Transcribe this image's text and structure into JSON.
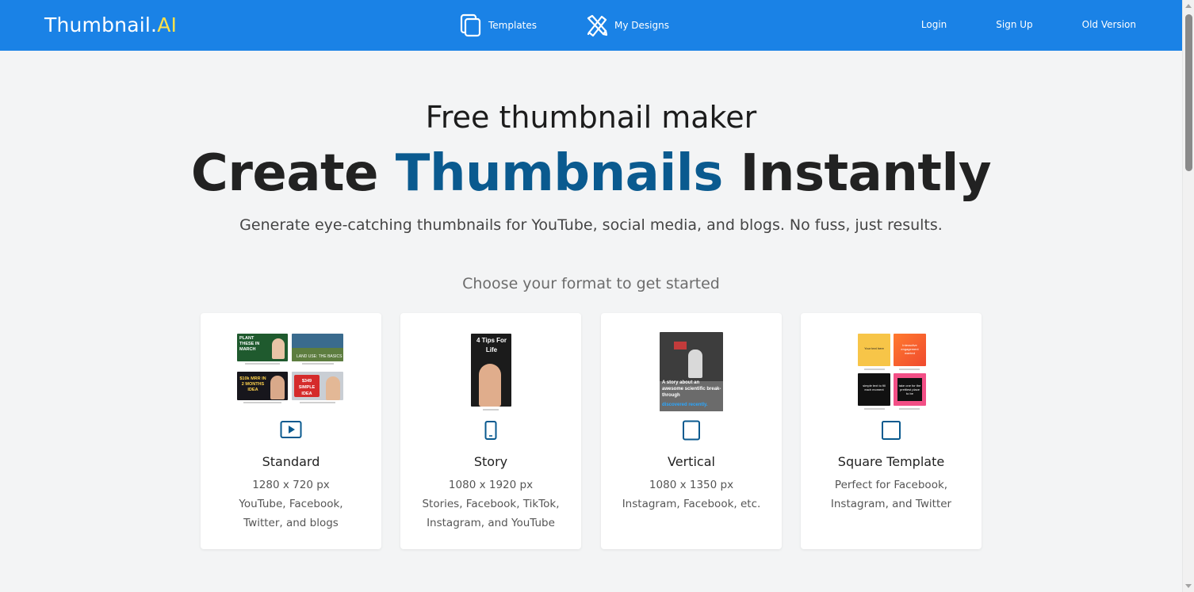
{
  "navbar": {
    "logo_main": "Thumbnail.",
    "logo_accent": "AI",
    "links": [
      {
        "label": "Templates",
        "icon": "templates-icon"
      },
      {
        "label": "My Designs",
        "icon": "design-tools-icon"
      }
    ],
    "auth": {
      "login": "Login",
      "signup": "Sign Up",
      "old_version": "Old Version"
    }
  },
  "hero": {
    "subtitle": "Free thumbnail maker",
    "title_part1": "Create ",
    "title_accent": "Thumbnails",
    "title_part2": " Instantly",
    "description": "Generate eye-catching thumbnails for YouTube, social media, and blogs. No fuss, just results.",
    "choose": "Choose your format to get started"
  },
  "formats": [
    {
      "title": "Standard",
      "size": "1280 x 720 px",
      "desc_lines": [
        "YouTube, Facebook,",
        "Twitter, and blogs"
      ],
      "icon": "play-icon"
    },
    {
      "title": "Story",
      "size": "1080 x 1920 px",
      "desc_lines": [
        "Stories, Facebook, TikTok,",
        "Instagram, and YouTube"
      ],
      "icon": "phone-icon"
    },
    {
      "title": "Vertical",
      "size": "1080 x 1350 px",
      "desc_lines": [
        "Instagram, Facebook, etc."
      ],
      "icon": "tablet-icon"
    },
    {
      "title": "Square Template",
      "size": "",
      "desc_lines": [
        "Perfect for Facebook,",
        "Instagram, and Twitter"
      ],
      "icon": "square-icon"
    }
  ],
  "previews": {
    "standard": [
      "PLANT THESE IN MARCH",
      "LAND USE: THE BASICS",
      "$10k MRR IN 2 MONTHS IDEA",
      "$349 SIMPLE IDEA"
    ],
    "story": [
      "4 Tips For Life"
    ],
    "vertical": [
      "A story about an awesome scientific break-through",
      "discovered recently."
    ],
    "square": [
      "Your text here",
      "Interactive engagement wanted",
      "simple text to fill each moment",
      "take one for the prettiest place to be"
    ]
  },
  "colors": {
    "nav_bg": "#1a82e6",
    "logo_accent": "#ffe14a",
    "title_accent": "#0a5a8f"
  }
}
